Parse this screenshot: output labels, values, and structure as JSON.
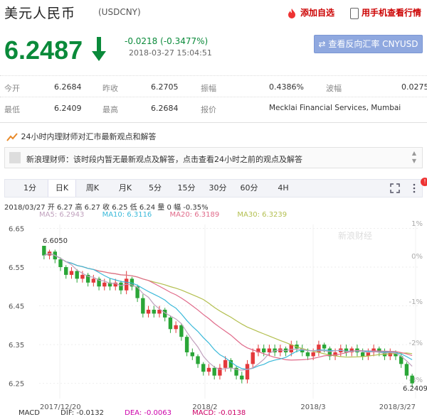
{
  "header": {
    "title": "美元人民币",
    "code": "(USDCNY)",
    "add_watchlist": "添加自选",
    "mobile_view": "用手机查看行情"
  },
  "quote": {
    "price": "6.2487",
    "change": "-0.0218 (-0.3477%)",
    "time": "2018-03-27 15:04:51",
    "reverse_button": "查看反向汇率 CNYUSD"
  },
  "stats": {
    "open_label": "今开",
    "open": "6.2684",
    "prev_label": "昨收",
    "prev": "6.2705",
    "amp_label": "振幅",
    "amp": "0.4386%",
    "wave_label": "波幅",
    "wave": "0.0275",
    "low_label": "最低",
    "low": "6.2409",
    "high_label": "最高",
    "high": "6.2684",
    "quote_label": "报价",
    "quote_src": "Mecklai Financial Services, Mumbai"
  },
  "news": {
    "headline": "24小时内理财师对汇市最新观点和解答",
    "message": "新浪理财师：该时段内暂无最新观点及解答，点击查看24小时之前的观点及解答"
  },
  "tabs": [
    "1分",
    "日K",
    "周K",
    "月K",
    "5分",
    "15分",
    "30分",
    "60分",
    "4H"
  ],
  "legend": {
    "line1": "2018/03/27  开 6.27  高 6.27  收 6.25  低 6.24  量 0  幅 -0.35%",
    "ma5": "MA5: 6.2943",
    "ma10": "MA10: 6.3116",
    "ma20": "MA20: 6.3189",
    "ma30": "MA30: 6.3239"
  },
  "macd": {
    "macd": "MACD",
    "dif": "DIF: -0.0132",
    "dea": "DEA: -0.0063",
    "macd_val": "MACD: -0.0138"
  },
  "watermark": "新浪财经",
  "colors": {
    "up": "#e4393c",
    "down": "#2aa637",
    "ma5": "#c0a1bd",
    "ma10": "#3ab9d9",
    "ma20": "#e06a8a",
    "ma30": "#b3bf4f",
    "price_down": "#0a8a3a"
  },
  "chart_data": {
    "type": "candlestick",
    "y_ticks": [
      "6.65",
      "6.55",
      "6.45",
      "6.35",
      "6.25"
    ],
    "y_pct_ticks": [
      "1%",
      "0%",
      "-1%",
      "-2%",
      "-3%"
    ],
    "x_labels": [
      "2017/12/20",
      "2018/2",
      "2018/3",
      "2018/3/27"
    ],
    "ylim": [
      6.22,
      6.66
    ],
    "annotations": {
      "high_label": "6.6050",
      "low_label": "6.2409"
    },
    "candles": [
      [
        6.605,
        6.58,
        6.605,
        6.57
      ],
      [
        6.58,
        6.59,
        6.595,
        6.57
      ],
      [
        6.59,
        6.57,
        6.595,
        6.56
      ],
      [
        6.57,
        6.55,
        6.575,
        6.54
      ],
      [
        6.55,
        6.53,
        6.555,
        6.52
      ],
      [
        6.53,
        6.54,
        6.55,
        6.52
      ],
      [
        6.54,
        6.52,
        6.545,
        6.51
      ],
      [
        6.52,
        6.53,
        6.54,
        6.51
      ],
      [
        6.53,
        6.51,
        6.535,
        6.5
      ],
      [
        6.51,
        6.52,
        6.53,
        6.5
      ],
      [
        6.52,
        6.5,
        6.525,
        6.49
      ],
      [
        6.5,
        6.51,
        6.52,
        6.49
      ],
      [
        6.51,
        6.5,
        6.52,
        6.49
      ],
      [
        6.5,
        6.51,
        6.52,
        6.49
      ],
      [
        6.51,
        6.49,
        6.515,
        6.48
      ],
      [
        6.49,
        6.52,
        6.54,
        6.48
      ],
      [
        6.52,
        6.5,
        6.525,
        6.49
      ],
      [
        6.5,
        6.47,
        6.505,
        6.46
      ],
      [
        6.47,
        6.43,
        6.48,
        6.42
      ],
      [
        6.43,
        6.44,
        6.45,
        6.42
      ],
      [
        6.44,
        6.43,
        6.45,
        6.42
      ],
      [
        6.43,
        6.44,
        6.45,
        6.42
      ],
      [
        6.44,
        6.42,
        6.445,
        6.41
      ],
      [
        6.42,
        6.39,
        6.425,
        6.38
      ],
      [
        6.39,
        6.4,
        6.41,
        6.38
      ],
      [
        6.4,
        6.37,
        6.405,
        6.36
      ],
      [
        6.37,
        6.33,
        6.375,
        6.32
      ],
      [
        6.33,
        6.32,
        6.34,
        6.31
      ],
      [
        6.32,
        6.3,
        6.325,
        6.29
      ],
      [
        6.3,
        6.28,
        6.305,
        6.27
      ],
      [
        6.28,
        6.29,
        6.3,
        6.27
      ],
      [
        6.29,
        6.27,
        6.295,
        6.26
      ],
      [
        6.27,
        6.29,
        6.3,
        6.26
      ],
      [
        6.29,
        6.31,
        6.32,
        6.28
      ],
      [
        6.31,
        6.29,
        6.315,
        6.28
      ],
      [
        6.29,
        6.27,
        6.295,
        6.26
      ],
      [
        6.27,
        6.26,
        6.28,
        6.25
      ],
      [
        6.26,
        6.3,
        6.31,
        6.25
      ],
      [
        6.3,
        6.33,
        6.34,
        6.29
      ],
      [
        6.33,
        6.34,
        6.35,
        6.32
      ],
      [
        6.34,
        6.33,
        6.35,
        6.32
      ],
      [
        6.33,
        6.34,
        6.35,
        6.32
      ],
      [
        6.34,
        6.33,
        6.35,
        6.32
      ],
      [
        6.33,
        6.34,
        6.35,
        6.32
      ],
      [
        6.34,
        6.33,
        6.345,
        6.32
      ],
      [
        6.33,
        6.35,
        6.36,
        6.32
      ],
      [
        6.35,
        6.34,
        6.36,
        6.33
      ],
      [
        6.34,
        6.33,
        6.35,
        6.32
      ],
      [
        6.33,
        6.32,
        6.34,
        6.31
      ],
      [
        6.32,
        6.33,
        6.34,
        6.31
      ],
      [
        6.33,
        6.35,
        6.36,
        6.32
      ],
      [
        6.35,
        6.34,
        6.355,
        6.33
      ],
      [
        6.34,
        6.32,
        6.345,
        6.31
      ],
      [
        6.32,
        6.33,
        6.34,
        6.31
      ],
      [
        6.33,
        6.34,
        6.35,
        6.32
      ],
      [
        6.34,
        6.33,
        6.35,
        6.32
      ],
      [
        6.33,
        6.34,
        6.345,
        6.32
      ],
      [
        6.34,
        6.33,
        6.35,
        6.32
      ],
      [
        6.33,
        6.32,
        6.34,
        6.31
      ],
      [
        6.32,
        6.33,
        6.34,
        6.31
      ],
      [
        6.33,
        6.34,
        6.35,
        6.32
      ],
      [
        6.34,
        6.33,
        6.345,
        6.32
      ],
      [
        6.33,
        6.32,
        6.34,
        6.31
      ],
      [
        6.32,
        6.33,
        6.34,
        6.31
      ],
      [
        6.33,
        6.32,
        6.335,
        6.31
      ],
      [
        6.32,
        6.3,
        6.325,
        6.29
      ],
      [
        6.3,
        6.27,
        6.305,
        6.26
      ],
      [
        6.27,
        6.25,
        6.275,
        6.24
      ]
    ]
  }
}
